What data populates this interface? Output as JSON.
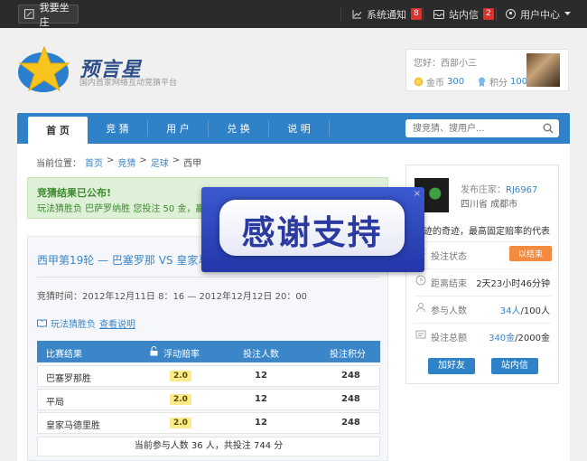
{
  "topbar": {
    "post_label": "我要坐庄",
    "notify_label": "系统通知",
    "notify_count": "8",
    "mail_label": "站内信",
    "mail_count": "2",
    "user_center_label": "用户中心"
  },
  "brand": {
    "name": "预言星",
    "slogan": "国内首家网络互动竞猜平台"
  },
  "user_card": {
    "greeting": "您好：西部小三",
    "gold_label": "金币",
    "gold_value": "300",
    "score_label": "积分",
    "score_value": "100"
  },
  "nav": {
    "tabs": [
      "首 页",
      "竞 猜",
      "用 户",
      "兑 换",
      "说 明"
    ],
    "search_placeholder": "搜竞猜、搜用户..."
  },
  "breadcrumb": {
    "prefix": "当前位置：",
    "items": [
      "首页",
      "竞猜",
      "足球"
    ],
    "current": "西甲",
    "sep": ">"
  },
  "alert": {
    "title": "竞猜结果已公布!",
    "detail": "玩法猜胜负 巴萨罗纳胜 您投注 50 金，赢得 20"
  },
  "match": {
    "title": "西甲第19轮 — 巴塞罗那 VS 皇家马德",
    "time": "竞猜时间：2012年12月11日 8：16 — 2012年12月12日 20：00",
    "rule_text": "玩法猜胜负",
    "rule_link": "查看说明"
  },
  "table": {
    "headers": [
      "比赛结果",
      "浮动赔率",
      "投注人数",
      "投注积分"
    ],
    "rows": [
      {
        "result": "巴塞罗那胜",
        "odds": "2.0",
        "people": "12",
        "points": "248"
      },
      {
        "result": "平局",
        "odds": "2.0",
        "people": "12",
        "points": "248"
      },
      {
        "result": "皇家马德里胜",
        "odds": "2.0",
        "people": "12",
        "points": "248"
      }
    ],
    "footer": "当前参与人数 36 人，共投注 744 分"
  },
  "side": {
    "poster_label": "发布庄家：",
    "poster_name": "RJ6967",
    "location": "四川省 成都市",
    "desc": "奇迹的奇迹，最高固定赔率的代表",
    "status_label": "投注状态",
    "status_value": "以结束",
    "remain_label": "距离结束",
    "remain_value": "2天23小时46分钟",
    "people_label": "参与人数",
    "people_value": "34人",
    "people_total": "/100人",
    "total_label": "投注总额",
    "total_value": "340金",
    "total_max": "/2000金",
    "add_friend": "加好友",
    "mail_btn": "站内信"
  },
  "overlay": {
    "text": "感谢支持"
  },
  "colors": {
    "nav": "#2f82c8",
    "accent": "#3b86c9",
    "status": "#f28a3f",
    "odds": "#fbe98a"
  }
}
